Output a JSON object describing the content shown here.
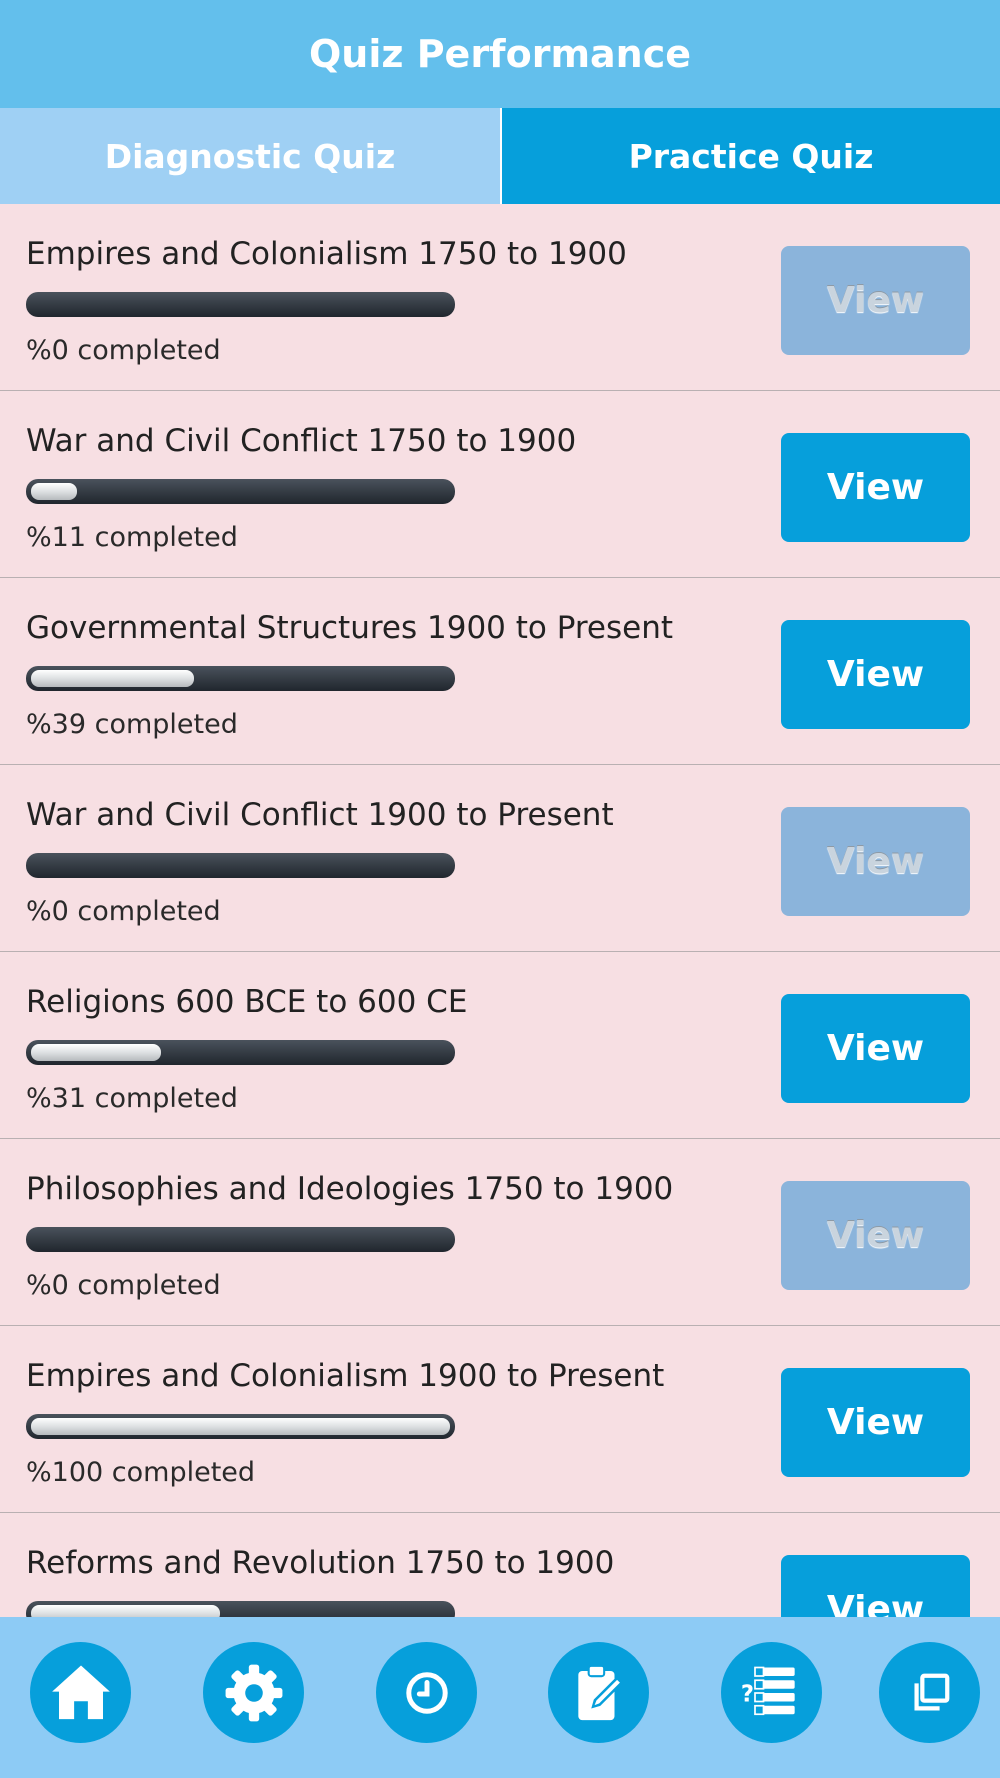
{
  "header": {
    "title": "Quiz Performance"
  },
  "tabs": [
    {
      "label": "Diagnostic Quiz",
      "active": true
    },
    {
      "label": "Practice Quiz",
      "active": false
    }
  ],
  "items": [
    {
      "title": "Empires and Colonialism 1750 to 1900",
      "progress": 0,
      "status": "%0 completed",
      "button_label": "View",
      "enabled": false
    },
    {
      "title": "War and Civil Conflict 1750 to 1900",
      "progress": 11,
      "status": "%11 completed",
      "button_label": "View",
      "enabled": true
    },
    {
      "title": "Governmental Structures 1900 to Present",
      "progress": 39,
      "status": "%39 completed",
      "button_label": "View",
      "enabled": true
    },
    {
      "title": "War and Civil Conflict 1900 to Present",
      "progress": 0,
      "status": "%0 completed",
      "button_label": "View",
      "enabled": false
    },
    {
      "title": "Religions 600 BCE to 600 CE",
      "progress": 31,
      "status": "%31 completed",
      "button_label": "View",
      "enabled": true
    },
    {
      "title": "Philosophies and Ideologies 1750 to 1900",
      "progress": 0,
      "status": "%0 completed",
      "button_label": "View",
      "enabled": false
    },
    {
      "title": "Empires and Colonialism 1900 to Present",
      "progress": 100,
      "status": "%100 completed",
      "button_label": "View",
      "enabled": true
    },
    {
      "title": "Reforms and Revolution 1750 to 1900",
      "progress": 45,
      "status": "",
      "button_label": "View",
      "enabled": true
    }
  ],
  "bottom_nav": [
    {
      "icon": "home-icon"
    },
    {
      "icon": "gear-icon"
    },
    {
      "icon": "clock-icon"
    },
    {
      "icon": "clipboard-edit-icon"
    },
    {
      "icon": "quiz-list-icon"
    },
    {
      "icon": "copy-icon"
    }
  ],
  "colors": {
    "header_bg": "#63bfec",
    "tab_active_bg": "#9fd0f4",
    "tab_inactive_bg": "#069fdb",
    "list_bg": "#f7dfe3",
    "button_bg": "#069fdb",
    "button_disabled_bg": "#8bb4db",
    "bottom_nav_bg": "#8dcbf5"
  }
}
